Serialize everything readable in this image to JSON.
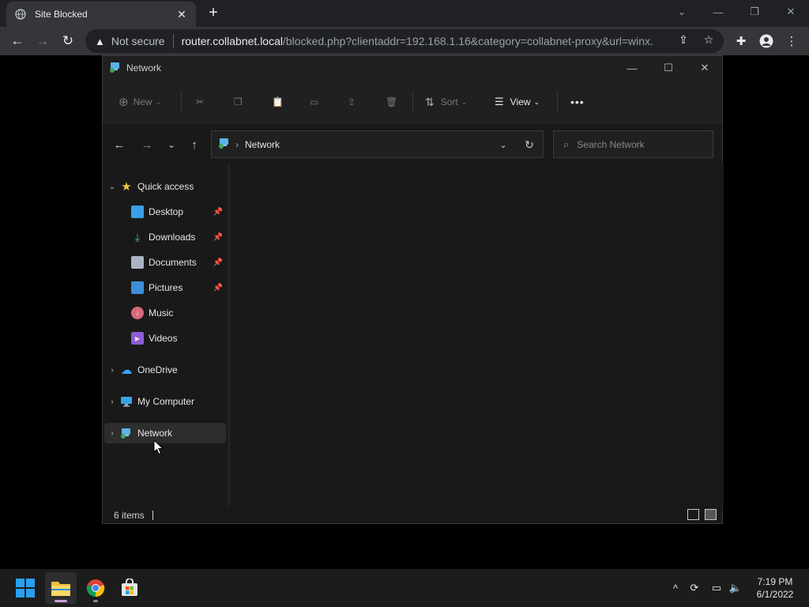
{
  "browser": {
    "tab_title": "Site Blocked",
    "new_tab": "+",
    "security_label": "Not secure",
    "url_host": "router.collabnet.local",
    "url_path": "/blocked.php?clientaddr=192.168.1.16&category=collabnet-proxy&url=winx..."
  },
  "explorer": {
    "window_title": "Network",
    "commands": {
      "new": "New",
      "sort": "Sort",
      "view": "View",
      "more": "•••"
    },
    "address": {
      "location": "Network"
    },
    "search": {
      "placeholder": "Search Network"
    },
    "sidebar": {
      "quick_access": "Quick access",
      "quick_items": [
        {
          "label": "Desktop",
          "icon": "desktop-icon",
          "pinned": true
        },
        {
          "label": "Downloads",
          "icon": "download-icon",
          "pinned": true
        },
        {
          "label": "Documents",
          "icon": "document-icon",
          "pinned": true
        },
        {
          "label": "Pictures",
          "icon": "pictures-icon",
          "pinned": true
        },
        {
          "label": "Music",
          "icon": "music-icon",
          "pinned": false
        },
        {
          "label": "Videos",
          "icon": "videos-icon",
          "pinned": false
        }
      ],
      "roots": [
        {
          "label": "OneDrive",
          "icon": "cloud-icon"
        },
        {
          "label": "My Computer",
          "icon": "computer-icon"
        },
        {
          "label": "Network",
          "icon": "network-icon"
        }
      ]
    },
    "status": {
      "items_count": "6 items"
    }
  },
  "taskbar": {
    "time": "7:19 PM",
    "date": "6/1/2022"
  },
  "colors": {
    "accent_blue": "#1c9ae6",
    "star_yellow": "#f6c744",
    "onedrive_blue": "#3aa0ff"
  }
}
